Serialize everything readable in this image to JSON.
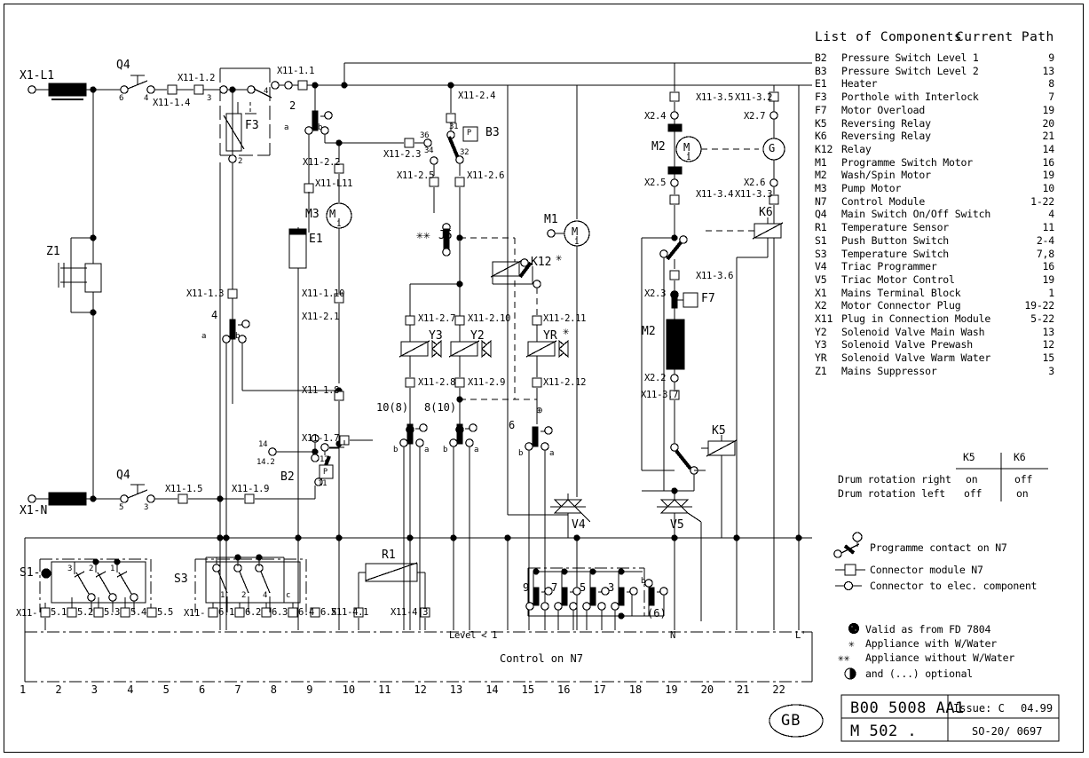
{
  "meta": {
    "country_code": "GB",
    "doc_number": "B00 5008 AA1",
    "issue": "Issue: C",
    "issue_date": "04.99",
    "model": "M 502 .",
    "drawing_ref": "SO-20/ 0697"
  },
  "components_list": {
    "title": "List of Components",
    "path_header": "Current Path",
    "rows": [
      {
        "id": "B2",
        "name": "Pressure Switch Level 1",
        "path": "9"
      },
      {
        "id": "B3",
        "name": "Pressure Switch Level 2",
        "path": "13"
      },
      {
        "id": "E1",
        "name": "Heater",
        "path": "8"
      },
      {
        "id": "F3",
        "name": "Porthole with Interlock",
        "path": "7"
      },
      {
        "id": "F7",
        "name": "Motor Overload",
        "path": "19"
      },
      {
        "id": "K5",
        "name": "Reversing Relay",
        "path": "20"
      },
      {
        "id": "K6",
        "name": "Reversing Relay",
        "path": "21"
      },
      {
        "id": "K12",
        "name": "Relay",
        "path": "14"
      },
      {
        "id": "M1",
        "name": "Programme Switch Motor",
        "path": "16"
      },
      {
        "id": "M2",
        "name": "Wash/Spin Motor",
        "path": "19"
      },
      {
        "id": "M3",
        "name": "Pump Motor",
        "path": "10"
      },
      {
        "id": "N7",
        "name": "Control Module",
        "path": "1-22"
      },
      {
        "id": "Q4",
        "name": "Main Switch On/Off Switch",
        "path": "4"
      },
      {
        "id": "R1",
        "name": "Temperature Sensor",
        "path": "11"
      },
      {
        "id": "S1",
        "name": "Push Button Switch",
        "path": "2-4"
      },
      {
        "id": "S3",
        "name": "Temperature Switch",
        "path": "7,8"
      },
      {
        "id": "V4",
        "name": "Triac Programmer",
        "path": "16"
      },
      {
        "id": "V5",
        "name": "Triac Motor Control",
        "path": "19"
      },
      {
        "id": "X1",
        "name": "Mains Terminal Block",
        "path": "1"
      },
      {
        "id": "X2",
        "name": "Motor Connector Plug",
        "path": "19-22"
      },
      {
        "id": "X11",
        "name": "Plug in Connection Module",
        "path": "5-22"
      },
      {
        "id": "Y2",
        "name": "Solenoid Valve Main Wash",
        "path": "13"
      },
      {
        "id": "Y3",
        "name": "Solenoid Valve Prewash",
        "path": "12"
      },
      {
        "id": "YR",
        "name": "Solenoid Valve Warm Water",
        "path": "15"
      },
      {
        "id": "Z1",
        "name": "Mains Suppressor",
        "path": "3"
      }
    ]
  },
  "rotation_table": {
    "col_k5": "K5",
    "col_k6": "K6",
    "rows": [
      {
        "label": "Drum rotation right",
        "k5": "on",
        "k6": "off"
      },
      {
        "label": "Drum rotation left",
        "k5": "off",
        "k6": "on"
      }
    ]
  },
  "symbol_legend": [
    {
      "symbol": "programme-contact-symbol",
      "text": "Programme contact on N7"
    },
    {
      "symbol": "connector-module-symbol",
      "text": "Connector module N7"
    },
    {
      "symbol": "connector-component-symbol",
      "text": "Connector to elec. component"
    }
  ],
  "notes": [
    {
      "marker": "⊕",
      "text": "Valid as from FD 7804"
    },
    {
      "marker": "✳",
      "text": "Appliance with W/Water"
    },
    {
      "marker": "✳✳",
      "text": "Appliance without W/Water"
    },
    {
      "marker": "◕",
      "text": "and (...) optional"
    }
  ],
  "bottom_bar": {
    "control_label": "Control on N7",
    "level_label": "Level < 1",
    "n_label": "N",
    "l_label": "L'",
    "paths": [
      "1",
      "2",
      "3",
      "4",
      "5",
      "6",
      "7",
      "8",
      "9",
      "10",
      "11",
      "12",
      "13",
      "14",
      "15",
      "16",
      "17",
      "18",
      "19",
      "20",
      "21",
      "22"
    ]
  },
  "schematic_labels": {
    "x1_l1": "X1-L1",
    "x1_n": "X1-N",
    "q4_top": "Q4",
    "q4_bottom": "Q4",
    "q4_top_left_num": "6",
    "q4_top_right_num": "4",
    "q4_bot_left_num": "5",
    "q4_bot_right_num": "3",
    "x11_1_4": "X11-1.4",
    "x11_1_2": "X11-1.2",
    "f3": "F3",
    "f3_num3": "3",
    "f3_num4": "4",
    "f3_num2": "2",
    "x11_1_1": "X11-1.1",
    "num2": "2",
    "a_left": "a",
    "b_right": "b",
    "x11_2_2": "X11-2.2",
    "x11_l11": "X11-L11",
    "m3": "M3",
    "e1": "E1",
    "z1": "Z1",
    "x11_1_3": "X11-1.3",
    "num4": "4",
    "a2": "a",
    "b2": "b",
    "x11_1_10": "X11-1.10",
    "x11_2_1": "X11-2.1",
    "x11_1_8": "X11-1.8",
    "x11_1_5": "X11-1.5",
    "x11_1_9": "X11-1.9",
    "x11_1_7": "X11-1.7",
    "b2_label": "B2",
    "b2_n14": "14",
    "b2_n142": "14.2",
    "b2_n12": "12",
    "b2_n11": "11",
    "b2_p": "P",
    "x11_2_4": "X11-2.4",
    "x11_2_3": "X11-2.3",
    "b3_label": "B3",
    "b3_n31": "31",
    "b3_n32": "32",
    "b3_n34": "34",
    "b3_n36": "36",
    "b3_p": "P",
    "x11_2_5": "X11-2.5",
    "x11_2_6": "X11-2.6",
    "j5": "J5",
    "j5_mark": "✳✳",
    "m1": "M1",
    "k12": "K12",
    "k12_mark": "✳",
    "x11_2_7": "X11-2.7",
    "x11_2_10": "X11-2.10",
    "x11_2_11": "X11-2.11",
    "y3": "Y3",
    "y2": "Y2",
    "yr": "YR",
    "yr_mark": "✳",
    "x11_2_8": "X11-2.8",
    "x11_2_9": "X11-2.9",
    "x11_2_12": "X11-2.12",
    "c10_8": "10(8)",
    "c8_10": "8(10)",
    "c6": "6",
    "b_a_1": "b",
    "b_a_1a": "a",
    "b_a_2": "b",
    "b_a_2a": "a",
    "b_a_3": "b",
    "b_a_3a": "a",
    "opt_mark": "⊕",
    "s1": "S1-",
    "s1_dot": "◕",
    "s1_n3": "3",
    "s1_n2": "2",
    "s1_n1": "1",
    "s3": "S3",
    "s3_n1": "1",
    "s3_n2": "2",
    "s3_n4": "4",
    "s3_c": "c",
    "x11_prefix_1": "X11-",
    "x11_prefix_2": "X11-",
    "x11_5_1": "5.1",
    "x11_5_2": "5.2",
    "x11_5_3": "5.3",
    "x11_5_4": "5.4",
    "x11_5_5": "5.5",
    "x11_6_1": "6.1",
    "x11_6_2": "6.2",
    "x11_6_3": "6.3",
    "x11_6_4": "6.4",
    "x11_6_5": "6.5",
    "r1": "R1",
    "x11_4_1": "X11-4.1",
    "x11_4_3": "X11-4.3",
    "v4": "V4",
    "v5": "V5",
    "n9": "9",
    "n7": "7",
    "n5": "5",
    "n3": "3",
    "n6p": "(6)",
    "bN": "b",
    "m2_top": "M2",
    "m2_bottom": "M2",
    "x11_3_5": "X11-3.5",
    "x11_3_2": "X11-3.2",
    "x2_4": "X2.4",
    "x2_7": "X2.7",
    "x2_5": "X2.5",
    "x2_6": "X2.6",
    "x11_3_4": "X11-3.4",
    "x11_3_3": "X11-3.3",
    "k6": "K6",
    "x11_3_6": "X11-3.6",
    "x2_3": "X2.3",
    "f7": "F7",
    "x2_2": "X2.2",
    "x11_3_7": "X11-3.7",
    "k5": "K5",
    "m_glyph": "M",
    "g_glyph": "G"
  }
}
